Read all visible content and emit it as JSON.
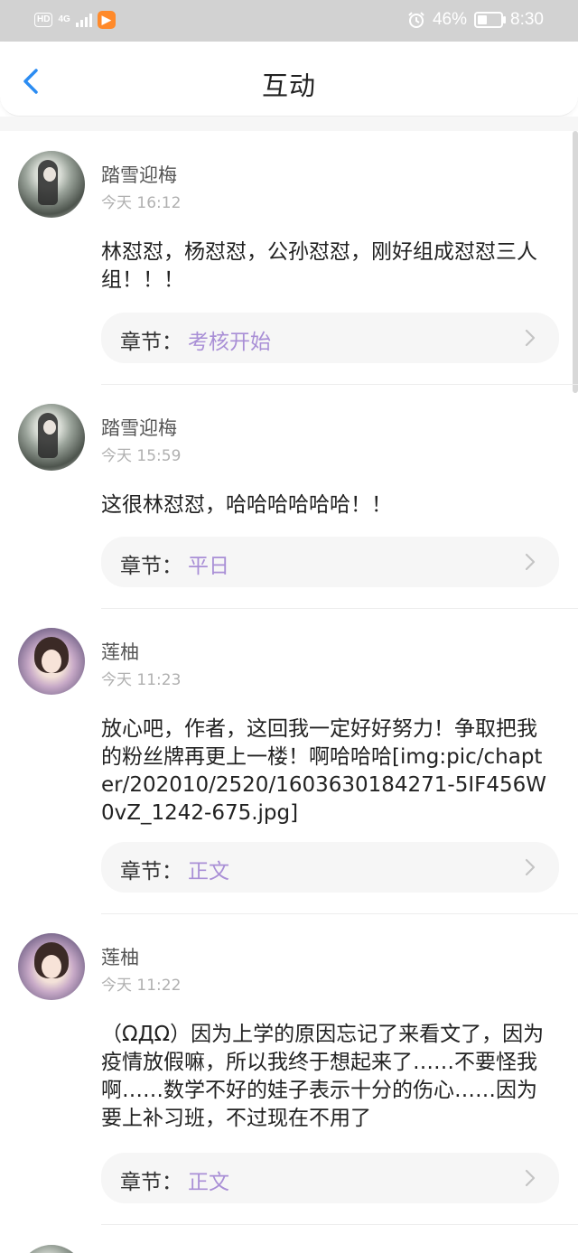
{
  "status_bar": {
    "hd": "HD",
    "network": "4G",
    "app_icon_glyph": "▶",
    "battery": "46%",
    "battery_level": 0.46,
    "time": "8:30",
    "icons": [
      "hd-icon",
      "signal-icon",
      "app-icon",
      "alarm-icon",
      "battery-icon"
    ]
  },
  "header": {
    "title": "互动",
    "back_icon": "chevron-left-icon",
    "accent": "#2b8cf2"
  },
  "chapter_prefix": "章节：",
  "chapter_color": "#a98fd6",
  "comments": [
    {
      "user": "踏雪迎梅",
      "time": "今天 16:12",
      "content": "林怼怼，杨怼怼，公孙怼怼，刚好组成怼怼三人组！！！",
      "chapter": "考核开始"
    },
    {
      "user": "踏雪迎梅",
      "time": "今天 15:59",
      "content": "这很林怼怼，哈哈哈哈哈哈！！",
      "chapter": "平日"
    },
    {
      "user": "莲柚",
      "time": "今天 11:23",
      "content": "放心吧，作者，这回我一定好好努力！争取把我的粉丝牌再更上一楼！啊哈哈哈[img:pic/chapter/202010/2520/1603630184271-5IF456W0vZ_1242-675.jpg]",
      "chapter": "正文"
    },
    {
      "user": "莲柚",
      "time": "今天 11:22",
      "content": "（ΩДΩ）因为上学的原因忘记了来看文了，因为疫情放假嘛，所以我终于想起来了……不要怪我啊……数学不好的娃子表示十分的伤心……因为要上补习班，不过现在不用了",
      "chapter": "正文"
    }
  ]
}
